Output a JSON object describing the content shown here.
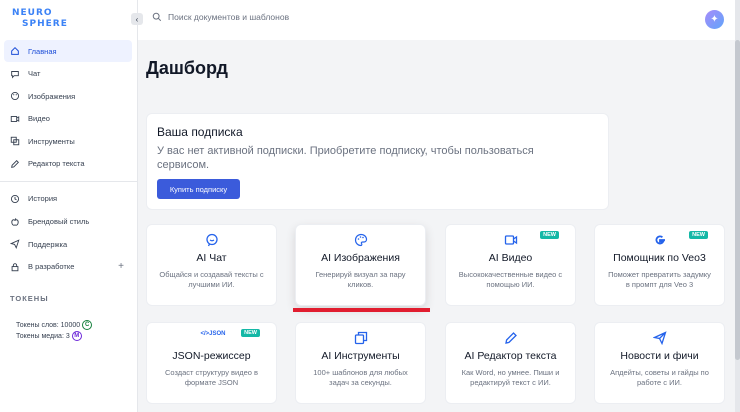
{
  "logo": {
    "line1": "NEURO",
    "line2": "SPHERE"
  },
  "search": {
    "placeholder": "Поиск документов и шаблонов"
  },
  "sidebar": {
    "items": [
      {
        "label": "Главная"
      },
      {
        "label": "Чат"
      },
      {
        "label": "Изображения"
      },
      {
        "label": "Видео"
      },
      {
        "label": "Инструменты"
      },
      {
        "label": "Редактор текста"
      },
      {
        "label": "История"
      },
      {
        "label": "Брендовый стиль"
      },
      {
        "label": "Поддержка"
      },
      {
        "label": "В разработке"
      }
    ],
    "tokens_title": "ТОКЕНЫ",
    "tokens_words": "Токены слов: 10000",
    "tokens_words_badge": "C",
    "tokens_media": "Токены медиа: 3",
    "tokens_media_badge": "M"
  },
  "main": {
    "title": "Дашборд",
    "subscription": {
      "title": "Ваша подписка",
      "text": "У вас нет активной подписки. Приобретите подписку, чтобы пользоваться сервисом.",
      "button": "Купить подписку"
    },
    "new_badge": "NEW",
    "cards": [
      {
        "title": "AI Чат",
        "desc": "Общайся и создавай тексты с лучшими ИИ."
      },
      {
        "title": "AI Изображения",
        "desc": "Генерируй визуал за пару кликов."
      },
      {
        "title": "AI Видео",
        "desc": "Высококачественные видео с помощью ИИ."
      },
      {
        "title": "Помощник по Veo3",
        "desc": "Поможет превратить задумку в промпт для Veo 3"
      },
      {
        "title": "JSON-режиссер",
        "desc": "Создаст структуру видео в формате JSON",
        "icon_text": "</>JSON"
      },
      {
        "title": "AI Инструменты",
        "desc": "100+ шаблонов для любых задач за секунды."
      },
      {
        "title": "AI Редактор текста",
        "desc": "Как Word, но умнее. Пиши и редактируй текст с ИИ."
      },
      {
        "title": "Новости и фичи",
        "desc": "Апдейты, советы и гайды по работе с ИИ."
      }
    ]
  },
  "colors": {
    "accent": "#3b5bdb",
    "badge": "#14b8a6",
    "highlight": "#e11d2f"
  }
}
